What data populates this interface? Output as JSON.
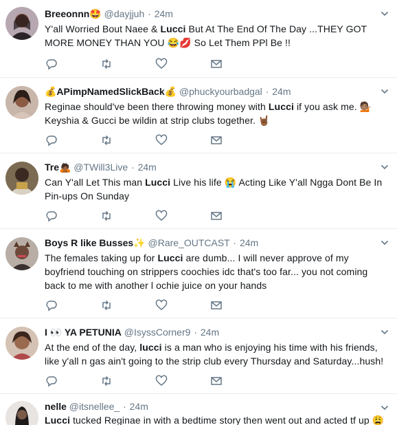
{
  "feed": {
    "tweets": [
      {
        "name": "Breeonnn",
        "name_emoji": "🤩",
        "handle": "@dayjjuh",
        "dot": "·",
        "time": "24m",
        "text": [
          {
            "t": "Y'all Worried Bout Naee & "
          },
          {
            "t": "Lucci",
            "b": true
          },
          {
            "t": " But At The End Of The Day ...THEY GOT MORE MONEY THAN YOU 😂💋 So Let Them PPl Be !!"
          }
        ]
      },
      {
        "name": "💰APimpNamedSlickBack💰",
        "name_emoji": "",
        "handle": "@phuckyourbadgal",
        "dot": "·",
        "time": "24m",
        "text": [
          {
            "t": "Reginae should've been there throwing money with "
          },
          {
            "t": "Lucci",
            "b": true
          },
          {
            "t": " if you ask me. 💁🏽 Keyshia & Gucci be wildin at strip clubs together. 🤘🏾"
          }
        ]
      },
      {
        "name": "Tre",
        "name_emoji": "🙇🏾",
        "handle": "@TWill3Live",
        "dot": "·",
        "time": "24m",
        "text": [
          {
            "t": "Can Y'all Let This man "
          },
          {
            "t": "Lucci",
            "b": true
          },
          {
            "t": " Live his life 😭 Acting Like Y'all N‌gga Dont Be In Pin-ups On Sunday"
          }
        ]
      },
      {
        "name": "Boys R like Busses",
        "name_emoji": "✨",
        "handle": "@Rare_OUTCAST",
        "dot": "·",
        "time": "24m",
        "text": [
          {
            "t": "The females taking up for "
          },
          {
            "t": "Lucci",
            "b": true
          },
          {
            "t": " are dumb... I will never approve of my boyfriend touching on strippers coochies idc that's too far... you not coming back to me with another l        ochie juice on your hands"
          }
        ]
      },
      {
        "name": "I 👀 YA PETUNIA",
        "name_emoji": "",
        "handle": "@IsyssCorner9",
        "dot": "·",
        "time": "24m",
        "text": [
          {
            "t": "At the end of the day, "
          },
          {
            "t": "lucci",
            "b": true
          },
          {
            "t": " is a man who is enjoying his time with his friends, like y'all n  gas ain't going to the strip club every Thursday and Saturday...hush!"
          }
        ]
      },
      {
        "name": "nelle",
        "name_emoji": "",
        "handle": "@itsnellee_",
        "dot": "·",
        "time": "24m",
        "text": [
          {
            "t": "Lucci",
            "b": true
          },
          {
            "t": " tucked Reginae in with a bedtime story then went out and acted tf up 😩"
          }
        ]
      }
    ]
  },
  "colors": {
    "text": "#14171a",
    "secondary": "#657786",
    "divider": "#e6ecf0",
    "icon": "#657786"
  },
  "icons": {
    "actions": [
      "reply-icon",
      "retweet-icon",
      "like-icon",
      "message-icon"
    ],
    "menu": "chevron-down-icon"
  }
}
